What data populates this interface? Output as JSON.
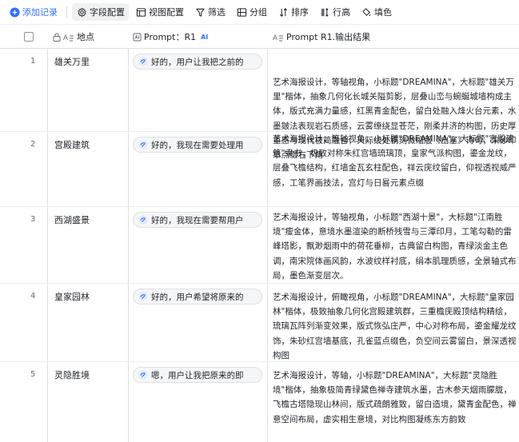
{
  "toolbar": {
    "add_record": "添加记录",
    "field_config": "字段配置",
    "view_config": "视图配置",
    "filter": "筛选",
    "group": "分组",
    "sort": "排序",
    "row_height": "行高",
    "fill_color": "填色"
  },
  "columns": {
    "place": "地点",
    "prompt": "Prompt：R1",
    "prompt_badge": "AI",
    "result": "Prompt R1.输出结果"
  },
  "rows": [
    {
      "num": "1",
      "place": "雄关万里",
      "prompt": "好的，用户让我把之前的",
      "result": "艺术海报设计，等轴视角，小标题\"DREAMINA\"，大标题\"雄关万里\"楷体，抽象几何化长城关隘剪影，层叠山峦与蜿蜒城墙构成主体，版式充满力量感，红黑青金配色，留白处融入烽火台元素，水墨皴法表现岩石质感，云雾缭绕显苍茫，刚柔并济的构图，历史厚重感与现代极简融合，天际线处镌刻微缩版《出塞》诗句，朱砂印章点缀右下角"
    },
    {
      "num": "2",
      "place": "宫殿建筑",
      "prompt": "好的，我现在需要处理用",
      "result": "艺术海报设计，等轴视角，小标题\"DREAMINA\"，大标题\"宫殿建筑\"隶书，极致对称朱红宫墙琉璃顶，皇家气派构图，鎏金龙纹，层叠飞檐结构，红墙金瓦玄柱配色，祥云庑纹留白，仰视透视威严感，工笔界画技法，宫灯与日晷元素点缀"
    },
    {
      "num": "3",
      "place": "西湖盛景",
      "prompt": "好的，我现在需要帮用户",
      "result": "艺术海报设计，等轴视角，小标题\"西湖十景\"，大标题\"江南胜境\"瘦金体，意境水墨渲染的断桥残雪与三潭印月，工笔勾勒的雷峰塔影，飘渺烟雨中的荷花垂柳，古典留白构图，青绿淡金主色调，南宋院体画风韵，水波纹样衬底，绢本肌理质感，全景轴式布局，墨色渐变层次。"
    },
    {
      "num": "4",
      "place": "皇家园林",
      "prompt": "好的，用户希望将原来的",
      "result": "艺术海报设计，俯瞰视角，小标题\"DREAMINA\"，大标题\"皇家园林\"楷体，极致抽象几何化宫殿建筑群，三重檐庑殿顶结构精绘，琉璃瓦阵列渐变效果，版式恢弘庄严，中心对称布局，鎏金耀龙纹饰，朱砂红宫墙基底，孔雀蓝点缀色，负空间云雾留白，景深透视构图"
    },
    {
      "num": "5",
      "place": "灵隐胜境",
      "prompt": "嗯，用户让我把原来的即",
      "result": "艺术海报设计，等轴，小标题\"DREAMINA\"，大标题\"灵隐胜境\"楷体，抽象极简青绿黛色禅寺建筑水墨，古木参天烟雨朦胧，飞檐古塔隐现山林间，版式疏朗雅致，留白造境，黛青金配色，禅意空间布局，虚实相生意境，对比构图凝练东方韵致"
    }
  ]
}
